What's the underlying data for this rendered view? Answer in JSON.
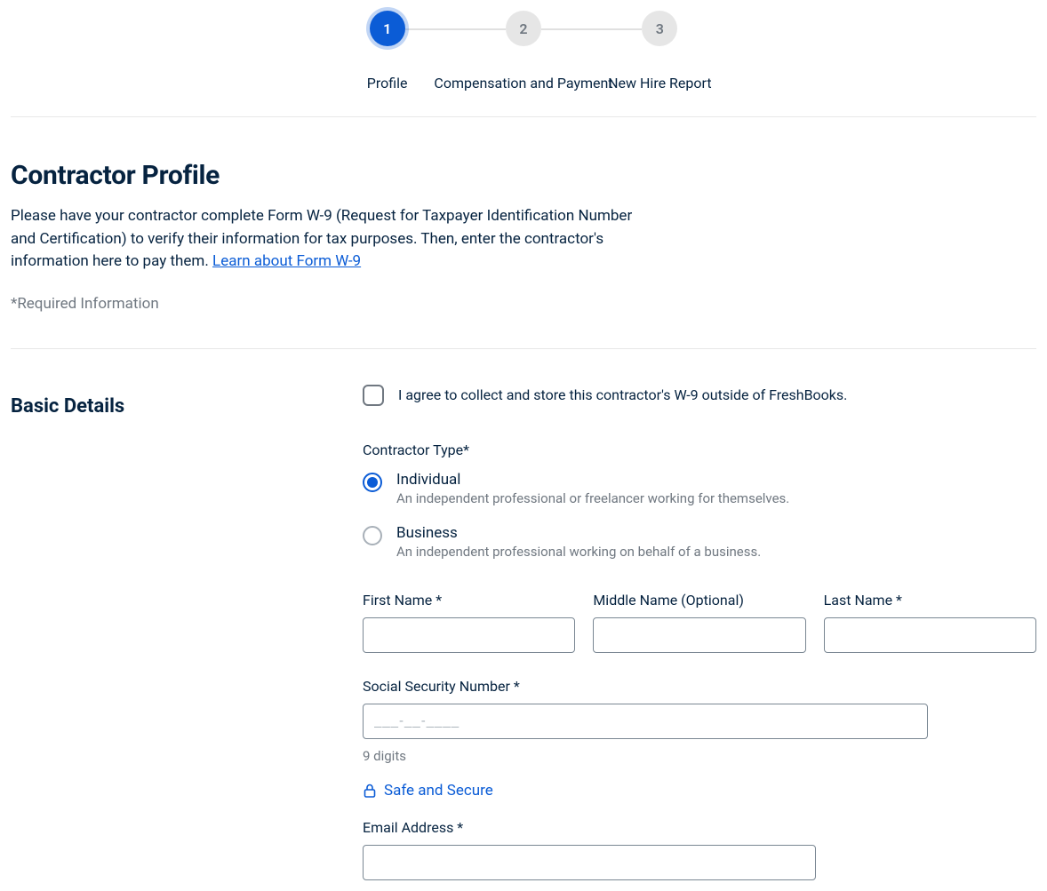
{
  "stepper": {
    "steps": [
      {
        "num": "1",
        "label": "Profile",
        "active": true
      },
      {
        "num": "2",
        "label": "Compensation and Payment",
        "active": false
      },
      {
        "num": "3",
        "label": "New Hire Report",
        "active": false
      }
    ]
  },
  "page": {
    "title": "Contractor Profile",
    "intro_text": "Please have your contractor complete Form W-9 (Request for Taxpayer Identification Number and Certification) to verify their information for tax purposes. Then, enter the contractor's information here to pay them. ",
    "intro_link": "Learn about Form W-9",
    "required_note": "*Required Information"
  },
  "section": {
    "title": "Basic Details"
  },
  "w9_checkbox": {
    "label": "I agree to collect and store this contractor's W-9 outside of FreshBooks.",
    "checked": false
  },
  "contractor_type": {
    "label": "Contractor Type*",
    "options": [
      {
        "title": "Individual",
        "desc": "An independent professional or freelancer working for themselves.",
        "selected": true
      },
      {
        "title": "Business",
        "desc": "An independent professional working on behalf of a business.",
        "selected": false
      }
    ]
  },
  "fields": {
    "first_name": {
      "label": "First Name *",
      "value": ""
    },
    "middle_name": {
      "label": "Middle Name (Optional)",
      "value": ""
    },
    "last_name": {
      "label": "Last Name *",
      "value": ""
    },
    "ssn": {
      "label": "Social Security Number *",
      "placeholder": "___-__-____",
      "hint": "9 digits",
      "value": ""
    },
    "safe_secure": "Safe and Secure",
    "email": {
      "label": "Email Address *",
      "value": ""
    }
  }
}
